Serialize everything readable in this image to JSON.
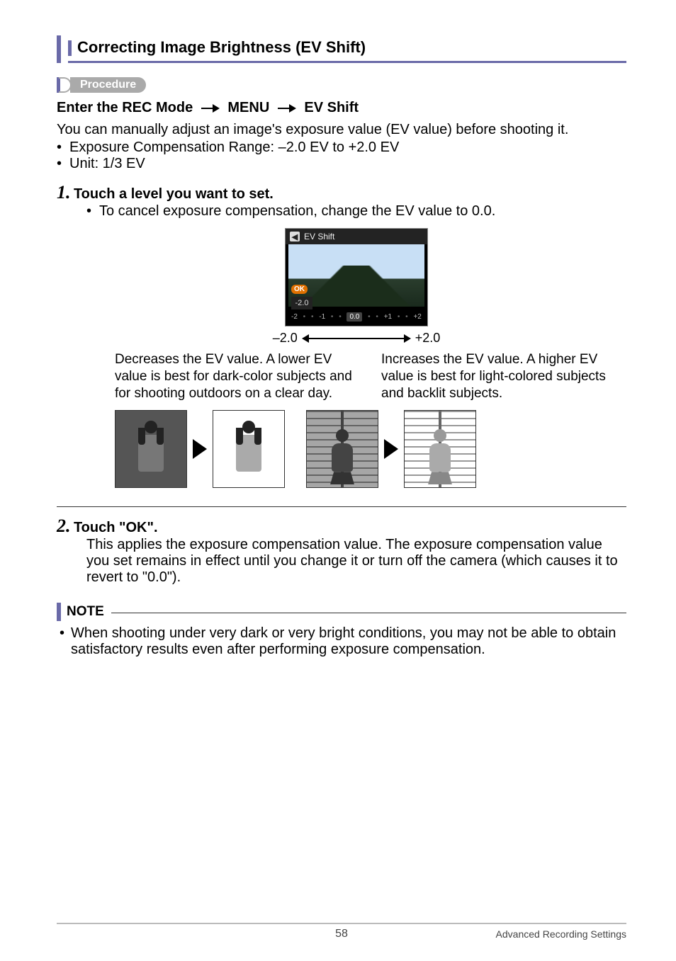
{
  "title": "Correcting Image Brightness (EV Shift)",
  "procedure_label": "Procedure",
  "breadcrumb": {
    "part1": "Enter the REC Mode",
    "part2": "MENU",
    "part3": "EV Shift"
  },
  "intro": "You can manually adjust an image's exposure value (EV value) before shooting it.",
  "bullets": {
    "b1": "Exposure Compensation Range: –2.0 EV to +2.0 EV",
    "b2": "Unit: 1/3 EV"
  },
  "step1": {
    "num": "1.",
    "title": "Touch a level you want to set.",
    "sub": "To cancel exposure compensation, change the EV value to 0.0."
  },
  "screenshot": {
    "header_title": "EV Shift",
    "ok": "OK",
    "current_value": "-2.0",
    "scale": {
      "n2": "-2",
      "n1": "-1",
      "zero": "0.0",
      "p1": "+1",
      "p2": "+2"
    }
  },
  "axis": {
    "left": "–2.0",
    "right": "+2.0"
  },
  "explain": {
    "left": "Decreases the EV value. A lower EV value is best for dark-color subjects and for shooting outdoors on a clear day.",
    "right": "Increases the EV value. A higher EV value is best for light-colored subjects and backlit subjects."
  },
  "step2": {
    "num": "2.",
    "title": "Touch \"OK\".",
    "body": "This applies the exposure compensation value. The exposure compensation value you set remains in effect until you change it or turn off the camera (which causes it to revert to \"0.0\")."
  },
  "note": {
    "label": "NOTE",
    "body": "When shooting under very dark or very bright conditions, you may not be able to obtain satisfactory results even after performing exposure compensation."
  },
  "footer": {
    "page": "58",
    "section": "Advanced Recording Settings"
  }
}
